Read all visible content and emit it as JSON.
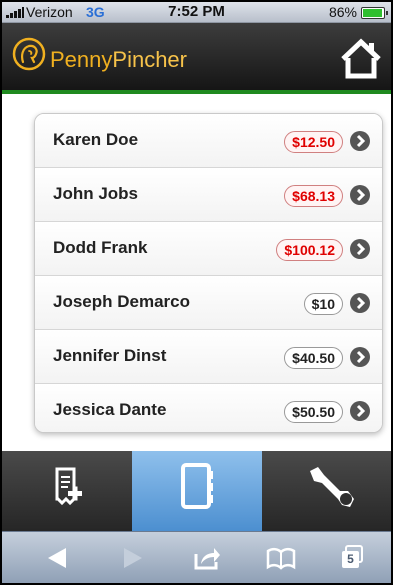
{
  "status_bar": {
    "carrier": "Verizon",
    "network": "3G",
    "time": "7:52 PM",
    "battery": "86%",
    "battery_level": 0.86
  },
  "header": {
    "brand_part1": "Penny",
    "brand_part2": "Pincher",
    "logo_icon": "coin-face-icon",
    "home_icon": "home-icon"
  },
  "contacts": [
    {
      "name": "Karen Doe",
      "amount": "$12.50",
      "owed": true
    },
    {
      "name": "John Jobs",
      "amount": "$68.13",
      "owed": true
    },
    {
      "name": "Dodd Frank",
      "amount": "$100.12",
      "owed": true
    },
    {
      "name": "Joseph Demarco",
      "amount": "$10",
      "owed": false
    },
    {
      "name": "Jennifer Dinst",
      "amount": "$40.50",
      "owed": false
    },
    {
      "name": "Jessica Dante",
      "amount": "$50.50",
      "owed": false
    }
  ],
  "tabs": [
    {
      "icon": "new-receipt-icon",
      "active": false
    },
    {
      "icon": "address-book-icon",
      "active": true
    },
    {
      "icon": "wrench-icon",
      "active": false
    }
  ],
  "browser_toolbar": {
    "back_icon": "back-arrow-icon",
    "forward_icon": "forward-arrow-icon",
    "share_icon": "share-icon",
    "bookmarks_icon": "bookmarks-icon",
    "tabs_count": "5"
  },
  "colors": {
    "brand": "#f0b020",
    "accent_green": "#1f8a1f",
    "owed_red": "#e00000",
    "active_tab": "#5a9ad8"
  }
}
